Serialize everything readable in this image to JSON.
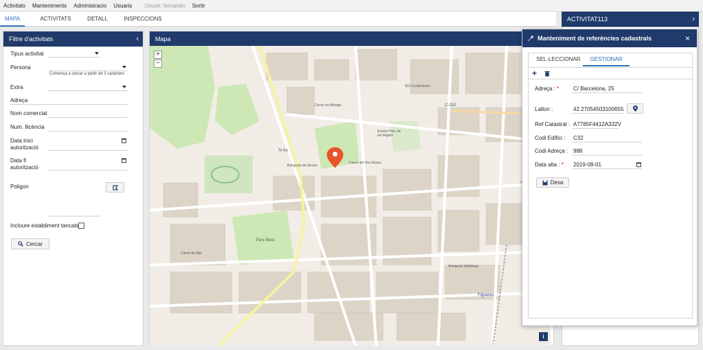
{
  "menu": {
    "items": [
      "Activitats",
      "Manteniments",
      "Administracio",
      "Usuaris"
    ],
    "user": "Usuari: fernando",
    "logout": "Sortir"
  },
  "tabs": [
    "MAPA",
    "ACTIVITATS",
    "DETALL",
    "INSPECCIONS"
  ],
  "filter": {
    "title": "Filtre d'activitats",
    "tipus": "Tipus activitat",
    "persona": "Persona",
    "persona_hint": "Comença a cercar a partir de 3 caràcters",
    "extra": "Extra",
    "adreca": "Adreça",
    "nom_comercial": "Nom comercial",
    "num_llicencia": "Num. llicència",
    "data_inici_1": "Data inici",
    "data_inici_2": "autorització",
    "data_fi_1": "Data fi",
    "data_fi_2": "autorització",
    "poligon": "Poligon",
    "incloure": "Incloure establiment tancats",
    "cercar": "Cercar"
  },
  "map": {
    "title": "Mapa",
    "zoom_in": "+",
    "zoom_out": "−",
    "info": "i",
    "labels": {
      "n2a": "N-IIa",
      "c252": "C-252",
      "parc_bosc": "Parc Bosc",
      "figueres": "Figueres",
      "escola": "Escola Parc de les Aigües",
      "ies": "IES Cendrassos",
      "montgo": "Carrer de Montgó",
      "rec_arnau": "Carrer del Rec Arnau",
      "girona": "Avinguda de Girona",
      "vilallonga": "Avinguda Vilallonga",
      "mar": "Carrer de Mar"
    }
  },
  "activity_card": {
    "title": "ACTIVITAT113",
    "chev": "›"
  },
  "modal": {
    "title": "Manteniment de referències cadastrals",
    "close": "×",
    "tabs": [
      "SEL·LECCIONAR",
      "GESTIONAR"
    ],
    "add": "+",
    "fields": {
      "adreca_label": "Adreça :",
      "adreca_value": "C/ Barcelona, 25",
      "latlon_label": "Latlon :",
      "latlon_value": "42.270545031006552",
      "ref_label": "Ref Catastral :",
      "ref_value": "A7785F4412A332V",
      "edifici_label": "Codi Edifici :",
      "edifici_value": "C32",
      "codi_adreca_label": "Codi Adreça :",
      "codi_adreca_value": "988",
      "data_alta_label": "Data alta :",
      "data_alta_value": "2019-08-01"
    },
    "required": "*",
    "save": "Desa"
  },
  "colors": {
    "header_navy": "#1f3a6b",
    "accent_blue": "#2a6fb8",
    "marker_orange": "#e8542b",
    "park_green": "#c8e6b5"
  }
}
